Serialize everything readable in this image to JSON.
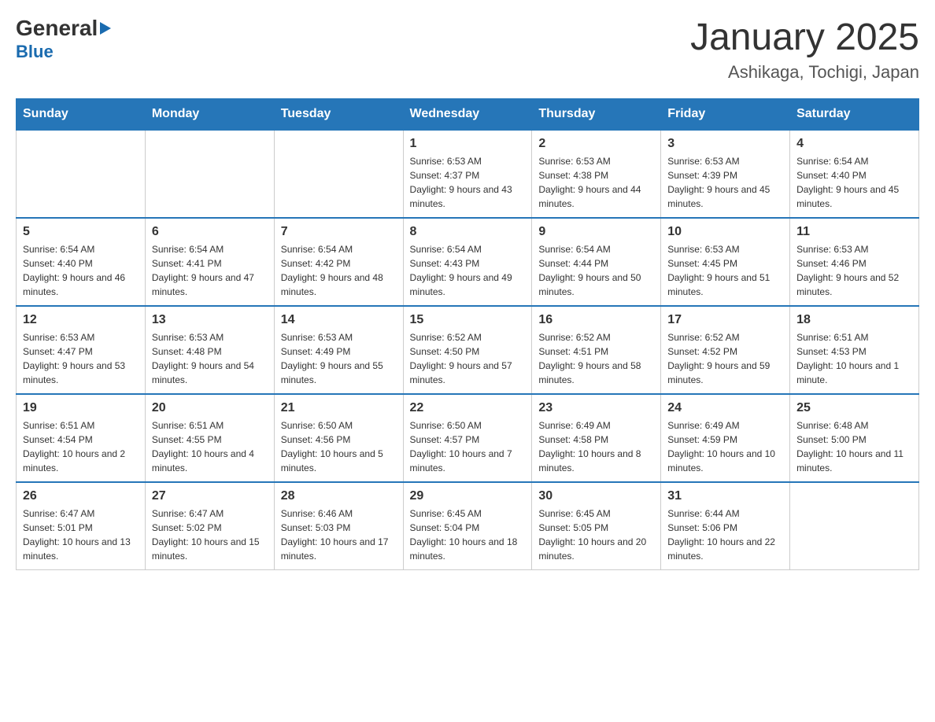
{
  "header": {
    "logo": {
      "general": "General",
      "blue": "Blue",
      "arrow": "▶"
    },
    "title": "January 2025",
    "subtitle": "Ashikaga, Tochigi, Japan"
  },
  "weekdays": [
    "Sunday",
    "Monday",
    "Tuesday",
    "Wednesday",
    "Thursday",
    "Friday",
    "Saturday"
  ],
  "weeks": [
    [
      {
        "day": "",
        "info": ""
      },
      {
        "day": "",
        "info": ""
      },
      {
        "day": "",
        "info": ""
      },
      {
        "day": "1",
        "info": "Sunrise: 6:53 AM\nSunset: 4:37 PM\nDaylight: 9 hours and 43 minutes."
      },
      {
        "day": "2",
        "info": "Sunrise: 6:53 AM\nSunset: 4:38 PM\nDaylight: 9 hours and 44 minutes."
      },
      {
        "day": "3",
        "info": "Sunrise: 6:53 AM\nSunset: 4:39 PM\nDaylight: 9 hours and 45 minutes."
      },
      {
        "day": "4",
        "info": "Sunrise: 6:54 AM\nSunset: 4:40 PM\nDaylight: 9 hours and 45 minutes."
      }
    ],
    [
      {
        "day": "5",
        "info": "Sunrise: 6:54 AM\nSunset: 4:40 PM\nDaylight: 9 hours and 46 minutes."
      },
      {
        "day": "6",
        "info": "Sunrise: 6:54 AM\nSunset: 4:41 PM\nDaylight: 9 hours and 47 minutes."
      },
      {
        "day": "7",
        "info": "Sunrise: 6:54 AM\nSunset: 4:42 PM\nDaylight: 9 hours and 48 minutes."
      },
      {
        "day": "8",
        "info": "Sunrise: 6:54 AM\nSunset: 4:43 PM\nDaylight: 9 hours and 49 minutes."
      },
      {
        "day": "9",
        "info": "Sunrise: 6:54 AM\nSunset: 4:44 PM\nDaylight: 9 hours and 50 minutes."
      },
      {
        "day": "10",
        "info": "Sunrise: 6:53 AM\nSunset: 4:45 PM\nDaylight: 9 hours and 51 minutes."
      },
      {
        "day": "11",
        "info": "Sunrise: 6:53 AM\nSunset: 4:46 PM\nDaylight: 9 hours and 52 minutes."
      }
    ],
    [
      {
        "day": "12",
        "info": "Sunrise: 6:53 AM\nSunset: 4:47 PM\nDaylight: 9 hours and 53 minutes."
      },
      {
        "day": "13",
        "info": "Sunrise: 6:53 AM\nSunset: 4:48 PM\nDaylight: 9 hours and 54 minutes."
      },
      {
        "day": "14",
        "info": "Sunrise: 6:53 AM\nSunset: 4:49 PM\nDaylight: 9 hours and 55 minutes."
      },
      {
        "day": "15",
        "info": "Sunrise: 6:52 AM\nSunset: 4:50 PM\nDaylight: 9 hours and 57 minutes."
      },
      {
        "day": "16",
        "info": "Sunrise: 6:52 AM\nSunset: 4:51 PM\nDaylight: 9 hours and 58 minutes."
      },
      {
        "day": "17",
        "info": "Sunrise: 6:52 AM\nSunset: 4:52 PM\nDaylight: 9 hours and 59 minutes."
      },
      {
        "day": "18",
        "info": "Sunrise: 6:51 AM\nSunset: 4:53 PM\nDaylight: 10 hours and 1 minute."
      }
    ],
    [
      {
        "day": "19",
        "info": "Sunrise: 6:51 AM\nSunset: 4:54 PM\nDaylight: 10 hours and 2 minutes."
      },
      {
        "day": "20",
        "info": "Sunrise: 6:51 AM\nSunset: 4:55 PM\nDaylight: 10 hours and 4 minutes."
      },
      {
        "day": "21",
        "info": "Sunrise: 6:50 AM\nSunset: 4:56 PM\nDaylight: 10 hours and 5 minutes."
      },
      {
        "day": "22",
        "info": "Sunrise: 6:50 AM\nSunset: 4:57 PM\nDaylight: 10 hours and 7 minutes."
      },
      {
        "day": "23",
        "info": "Sunrise: 6:49 AM\nSunset: 4:58 PM\nDaylight: 10 hours and 8 minutes."
      },
      {
        "day": "24",
        "info": "Sunrise: 6:49 AM\nSunset: 4:59 PM\nDaylight: 10 hours and 10 minutes."
      },
      {
        "day": "25",
        "info": "Sunrise: 6:48 AM\nSunset: 5:00 PM\nDaylight: 10 hours and 11 minutes."
      }
    ],
    [
      {
        "day": "26",
        "info": "Sunrise: 6:47 AM\nSunset: 5:01 PM\nDaylight: 10 hours and 13 minutes."
      },
      {
        "day": "27",
        "info": "Sunrise: 6:47 AM\nSunset: 5:02 PM\nDaylight: 10 hours and 15 minutes."
      },
      {
        "day": "28",
        "info": "Sunrise: 6:46 AM\nSunset: 5:03 PM\nDaylight: 10 hours and 17 minutes."
      },
      {
        "day": "29",
        "info": "Sunrise: 6:45 AM\nSunset: 5:04 PM\nDaylight: 10 hours and 18 minutes."
      },
      {
        "day": "30",
        "info": "Sunrise: 6:45 AM\nSunset: 5:05 PM\nDaylight: 10 hours and 20 minutes."
      },
      {
        "day": "31",
        "info": "Sunrise: 6:44 AM\nSunset: 5:06 PM\nDaylight: 10 hours and 22 minutes."
      },
      {
        "day": "",
        "info": ""
      }
    ]
  ]
}
